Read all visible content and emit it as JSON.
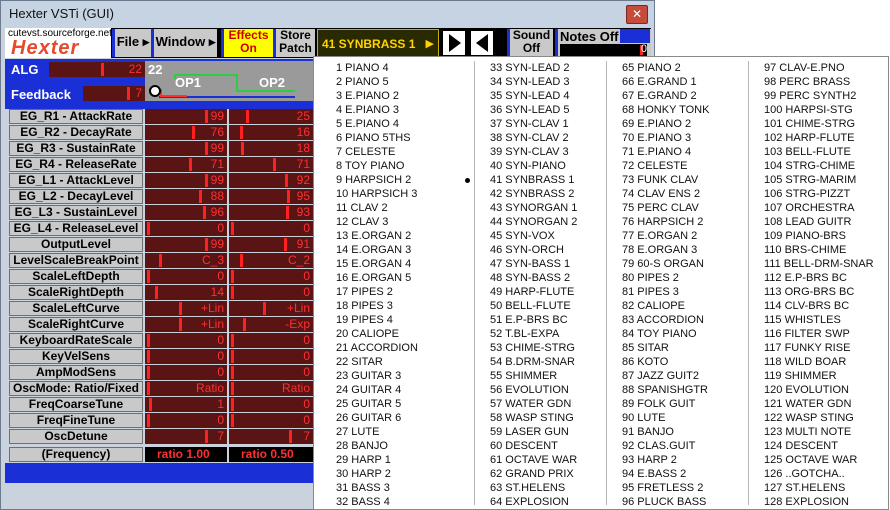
{
  "window": {
    "title": "Hexter VSTi (GUI)",
    "close_label": "✕"
  },
  "toolbar": {
    "logo_url": "cutevst.sourceforge.net",
    "logo_name": "Hexter",
    "file": "File",
    "window_menu": "Window",
    "effects_1": "Effects",
    "effects_2": "On",
    "store_1": "Store",
    "store_2": "Patch",
    "program": "41 SYNBRASS 1",
    "sound_1": "Sound",
    "sound_2": "Off",
    "notes_off": "Notes Off",
    "notes_value": "0"
  },
  "alg": {
    "label": "ALG",
    "value": "22",
    "diagram_num": "22",
    "op1": "OP1",
    "op2": "OP2",
    "op1_mark": "0"
  },
  "feedback": {
    "label": "Feedback",
    "value": "7"
  },
  "params": [
    {
      "label": "EG_R1 - AttackRate",
      "v1": "99",
      "v2": "25",
      "f1": 1.0,
      "f2": 0.25
    },
    {
      "label": "EG_R2 - DecayRate",
      "v1": "76",
      "v2": "16",
      "f1": 0.77,
      "f2": 0.16
    },
    {
      "label": "EG_R3 - SustainRate",
      "v1": "99",
      "v2": "18",
      "f1": 1.0,
      "f2": 0.18
    },
    {
      "label": "EG_R4 - ReleaseRate",
      "v1": "71",
      "v2": "71",
      "f1": 0.72,
      "f2": 0.72
    },
    {
      "label": "EG_L1 - AttackLevel",
      "v1": "99",
      "v2": "92",
      "f1": 1.0,
      "f2": 0.93
    },
    {
      "label": "EG_L2 - DecayLevel",
      "v1": "88",
      "v2": "95",
      "f1": 0.89,
      "f2": 0.96
    },
    {
      "label": "EG_L3 - SustainLevel",
      "v1": "96",
      "v2": "93",
      "f1": 0.97,
      "f2": 0.94
    },
    {
      "label": "EG_L4 - ReleaseLevel",
      "v1": "0",
      "v2": "0",
      "f1": 0.0,
      "f2": 0.0
    },
    {
      "label": "OutputLevel",
      "v1": "99",
      "v2": "91",
      "f1": 1.0,
      "f2": 0.92
    },
    {
      "label": "LevelScaleBreakPoint",
      "v1": "C_3",
      "v2": "C_2",
      "f1": 0.2,
      "f2": 0.15
    },
    {
      "label": "ScaleLeftDepth",
      "v1": "0",
      "v2": "0",
      "f1": 0.0,
      "f2": 0.0
    },
    {
      "label": "ScaleRightDepth",
      "v1": "14",
      "v2": "0",
      "f1": 0.14,
      "f2": 0.0
    },
    {
      "label": "ScaleLeftCurve",
      "v1": "+Lin",
      "v2": "+Lin",
      "f1": 0.55,
      "f2": 0.55
    },
    {
      "label": "ScaleRightCurve",
      "v1": "+Lin",
      "v2": "-Exp",
      "f1": 0.55,
      "f2": 0.2
    },
    {
      "label": "KeyboardRateScale",
      "v1": "0",
      "v2": "0",
      "f1": 0.0,
      "f2": 0.0
    },
    {
      "label": "KeyVelSens",
      "v1": "0",
      "v2": "0",
      "f1": 0.0,
      "f2": 0.0
    },
    {
      "label": "AmpModSens",
      "v1": "0",
      "v2": "0",
      "f1": 0.0,
      "f2": 0.0
    },
    {
      "label": "OscMode: Ratio/Fixed",
      "v1": "Ratio",
      "v2": "Ratio",
      "f1": 0.0,
      "f2": 0.0
    },
    {
      "label": "FreqCoarseTune",
      "v1": "1",
      "v2": "0",
      "f1": 0.03,
      "f2": 0.0
    },
    {
      "label": "FreqFineTune",
      "v1": "0",
      "v2": "0",
      "f1": 0.0,
      "f2": 0.0
    },
    {
      "label": "OscDetune",
      "v1": "7",
      "v2": "7",
      "f1": 1.0,
      "f2": 1.0
    }
  ],
  "frequency": {
    "label": "(Frequency)",
    "v1": "ratio 1.00",
    "v2": "ratio 0.50"
  },
  "programs": [
    [
      "1 PIANO   4",
      "2 PIANO   5",
      "3 E.PIANO 2",
      "4 E.PIANO 3",
      "5 E.PIANO 4",
      "6 PIANO 5THS",
      "7 CELESTE",
      "8 TOY PIANO",
      "9 HARPSICH 2",
      "10 HARPSICH 3",
      "11 CLAV   2",
      "12 CLAV   3",
      "13 E.ORGAN 2",
      "14 E.ORGAN 3",
      "15 E.ORGAN 4",
      "16 E.ORGAN 5",
      "17 PIPES   2",
      "18 PIPES   3",
      "19 PIPES   4",
      "20 CALIOPE",
      "21 ACCORDION",
      "22 SITAR",
      "23 GUITAR  3",
      "24 GUITAR  4",
      "25 GUITAR  5",
      "26 GUITAR  6",
      "27 LUTE",
      "28 BANJO",
      "29 HARP    1",
      "30 HARP    2",
      "31 BASS    3",
      "32 BASS    4"
    ],
    [
      "33 SYN-LEAD 2",
      "34 SYN-LEAD 3",
      "35 SYN-LEAD 4",
      "36 SYN-LEAD 5",
      "37 SYN-CLAV 1",
      "38 SYN-CLAV 2",
      "39 SYN-CLAV 3",
      "40 SYN-PIANO",
      "41 SYNBRASS 1",
      "42 SYNBRASS 2",
      "43 SYNORGAN 1",
      "44 SYNORGAN 2",
      "45 SYN-VOX",
      "46 SYN-ORCH",
      "47 SYN-BASS 1",
      "48 SYN-BASS 2",
      "49 HARP-FLUTE",
      "50 BELL-FLUTE",
      "51 E.P-BRS BC",
      "52 T.BL-EXPA",
      "53 CHIME-STRG",
      "54 B.DRM-SNAR",
      "55 SHIMMER",
      "56 EVOLUTION",
      "57 WATER GDN",
      "58 WASP STING",
      "59 LASER GUN",
      "60 DESCENT",
      "61 OCTAVE WAR",
      "62 GRAND PRIX",
      "63 ST.HELENS",
      "64 EXPLOSION"
    ],
    [
      "65 PIANO   2",
      "66 E.GRAND 1",
      "67 E.GRAND 2",
      "68 HONKY TONK",
      "69 E.PIANO 2",
      "70 E.PIANO 3",
      "71 E.PIANO 4",
      "72 CELESTE",
      "73 FUNK CLAV",
      "74 CLAV ENS 2",
      "75 PERC CLAV",
      "76 HARPSICH 2",
      "77 E.ORGAN 2",
      "78 E.ORGAN 3",
      "79 60-S ORGAN",
      "80 PIPES   2",
      "81 PIPES   3",
      "82 CALIOPE",
      "83 ACCORDION",
      "84 TOY PIANO",
      "85 SITAR",
      "86 KOTO",
      "87 JAZZ GUIT2",
      "88 SPANISHGTR",
      "89 FOLK GUIT",
      "90 LUTE",
      "91 BANJO",
      "92 CLAS.GUIT",
      "93 HARP    2",
      "94 E.BASS  2",
      "95 FRETLESS 2",
      "96 PLUCK BASS"
    ],
    [
      "97 CLAV-E.PNO",
      "98 PERC BRASS",
      "99 PERC SYNTH2",
      "100 HARPSI-STG",
      "101 CHIME-STRG",
      "102 HARP-FLUTE",
      "103 BELL-FLUTE",
      "104 STRG-CHIME",
      "105 STRG-MARIM",
      "106 STRG-PIZZT",
      "107 ORCHESTRA",
      "108 LEAD GUITR",
      "109 PIANO-BRS",
      "110 BRS-CHIME",
      "111 BELL-DRM-SNAR",
      "112 E.P-BRS BC",
      "113 ORG-BRS BC",
      "114 CLV-BRS BC",
      "115 WHISTLES",
      "116 FILTER SWP",
      "117 FUNKY RISE",
      "118 WILD BOAR",
      "119 SHIMMER",
      "120 EVOLUTION",
      "121 WATER GDN",
      "122 WASP STING",
      "123 MULTI NOTE",
      "124 DESCENT",
      "125 OCTAVE WAR",
      "126 ..GOTCHA..",
      "127 ST.HELENS",
      "128 EXPLOSION"
    ]
  ],
  "colors": {
    "panel_blue": "#1b2fd6",
    "value_red": "#ff3030",
    "value_bg": "#5a1414",
    "effects_yellow": "#ffff00",
    "program_gold": "#ffd200"
  }
}
